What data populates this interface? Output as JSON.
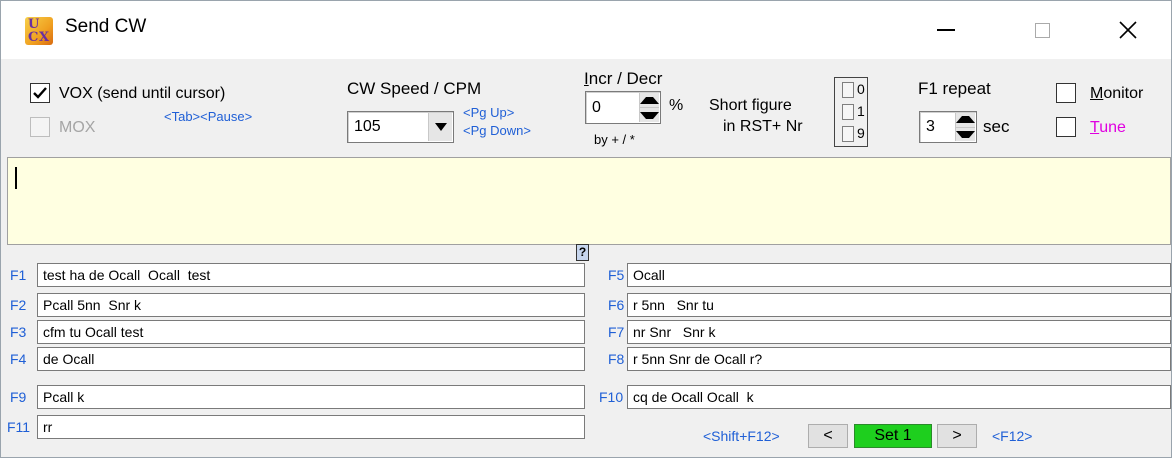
{
  "window": {
    "title": "Send CW",
    "icon_text": [
      "U",
      "C",
      "X"
    ]
  },
  "vox": {
    "label": "VOX (send until cursor)",
    "checked": true
  },
  "mox": {
    "label": "MOX",
    "checked": false,
    "disabled": true
  },
  "vox_hint": "<Tab><Pause>",
  "cw_speed": {
    "label": "CW Speed / CPM",
    "value": "105",
    "hint_up": "<Pg Up>",
    "hint_down": "<Pg Down>"
  },
  "incr_decr": {
    "label": "Incr / Decr",
    "value": "0",
    "unit": "%",
    "by_label": "by + / *"
  },
  "short_figure": {
    "label_line1": "Short figure",
    "label_line2": "in RST+ Nr",
    "options": [
      "0",
      "1",
      "9"
    ]
  },
  "f1_repeat": {
    "label": "F1 repeat",
    "value": "3",
    "unit": "sec"
  },
  "monitor": {
    "label": "Monitor",
    "checked": false
  },
  "tune": {
    "label": "Tune",
    "checked": false
  },
  "help_label": "?",
  "macros_left": [
    {
      "key": "F1",
      "text": "test ha de Ocall  Ocall  test"
    },
    {
      "key": "F2",
      "text": "Pcall 5nn  Snr k"
    },
    {
      "key": "F3",
      "text": "cfm tu Ocall test"
    },
    {
      "key": "F4",
      "text": "de Ocall"
    }
  ],
  "macros_right": [
    {
      "key": "F5",
      "text": "Ocall"
    },
    {
      "key": "F6",
      "text": "r 5nn   Snr tu"
    },
    {
      "key": "F7",
      "text": "nr Snr   Snr k"
    },
    {
      "key": "F8",
      "text": "r 5nn Snr de Ocall r?"
    }
  ],
  "macro_f9": {
    "key": "F9",
    "text": "Pcall k"
  },
  "macro_f10": {
    "key": "F10",
    "text": "cq de Ocall Ocall  k"
  },
  "macro_f11": {
    "key": "F11",
    "text": "rr"
  },
  "nav": {
    "shift_f12": "<Shift+F12>",
    "prev": "<",
    "set": "Set 1",
    "next": ">",
    "f12": "<F12>"
  },
  "colors": {
    "accent_blue": "#1f5fd6",
    "message_bg": "#ffffe1",
    "set_green": "#1ecf1e",
    "tune_magenta": "#e000e0"
  },
  "icons": [
    "app-icon",
    "minimize-icon",
    "maximize-icon",
    "close-icon",
    "checkmark-icon",
    "dropdown-arrow-icon",
    "spin-up-icon",
    "spin-down-icon"
  ]
}
